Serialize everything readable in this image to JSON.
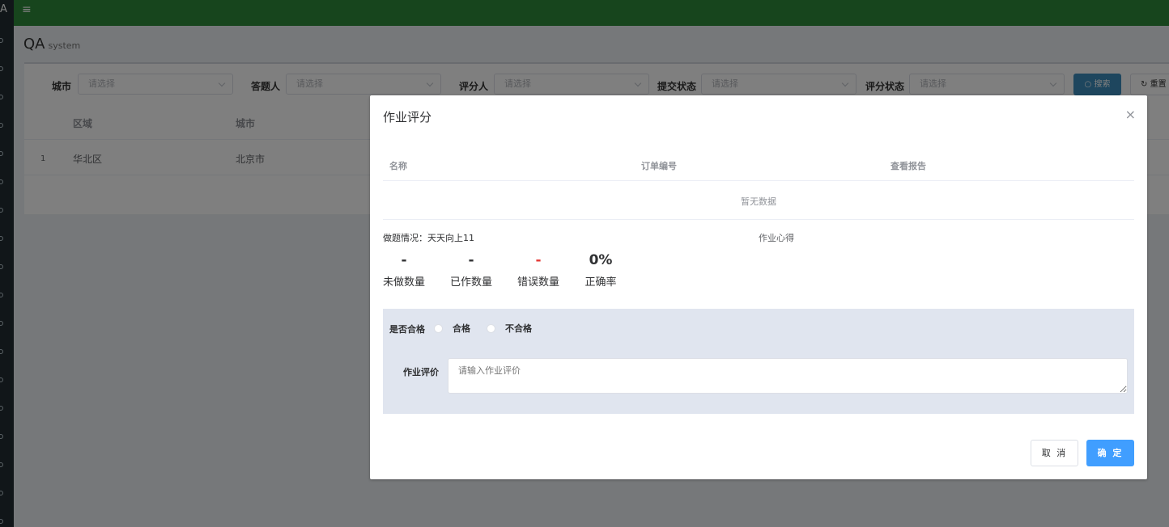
{
  "app": {
    "logo_text": "A",
    "page_title": "QA",
    "page_subtitle": "system",
    "menu_icon": "≡"
  },
  "filters": {
    "city_label": "城市",
    "answerer_label": "答题人",
    "grader_label": "评分人",
    "submit_status_label": "提交状态",
    "grade_status_label": "评分状态",
    "placeholder": "请选择",
    "search_button": "搜索",
    "reset_button": "重置"
  },
  "table": {
    "columns": [
      "区域",
      "城市"
    ],
    "rows": [
      {
        "index": "1",
        "region": "华北区",
        "city": "北京市"
      }
    ]
  },
  "modal": {
    "title": "作业评分",
    "close_icon": "×",
    "columns": [
      "名称",
      "订单编号",
      "查看报告"
    ],
    "empty_text": "暂无数据",
    "status_prefix": "做题情况：",
    "status_value": "天天向上11",
    "summary_label": "作业心得",
    "stats": [
      {
        "value": "-",
        "label": "未做数量",
        "color": "#303133"
      },
      {
        "value": "-",
        "label": "已作数量",
        "color": "#303133"
      },
      {
        "value": "-",
        "label": "错误数量",
        "color": "#e53935"
      },
      {
        "value": "0%",
        "label": "正确率",
        "color": "#303133"
      }
    ],
    "pass_label": "是否合格",
    "pass_option": "合格",
    "fail_option": "不合格",
    "eval_label": "作业评价",
    "eval_placeholder": "请输入作业评价",
    "cancel_button": "取 消",
    "ok_button": "确 定"
  }
}
